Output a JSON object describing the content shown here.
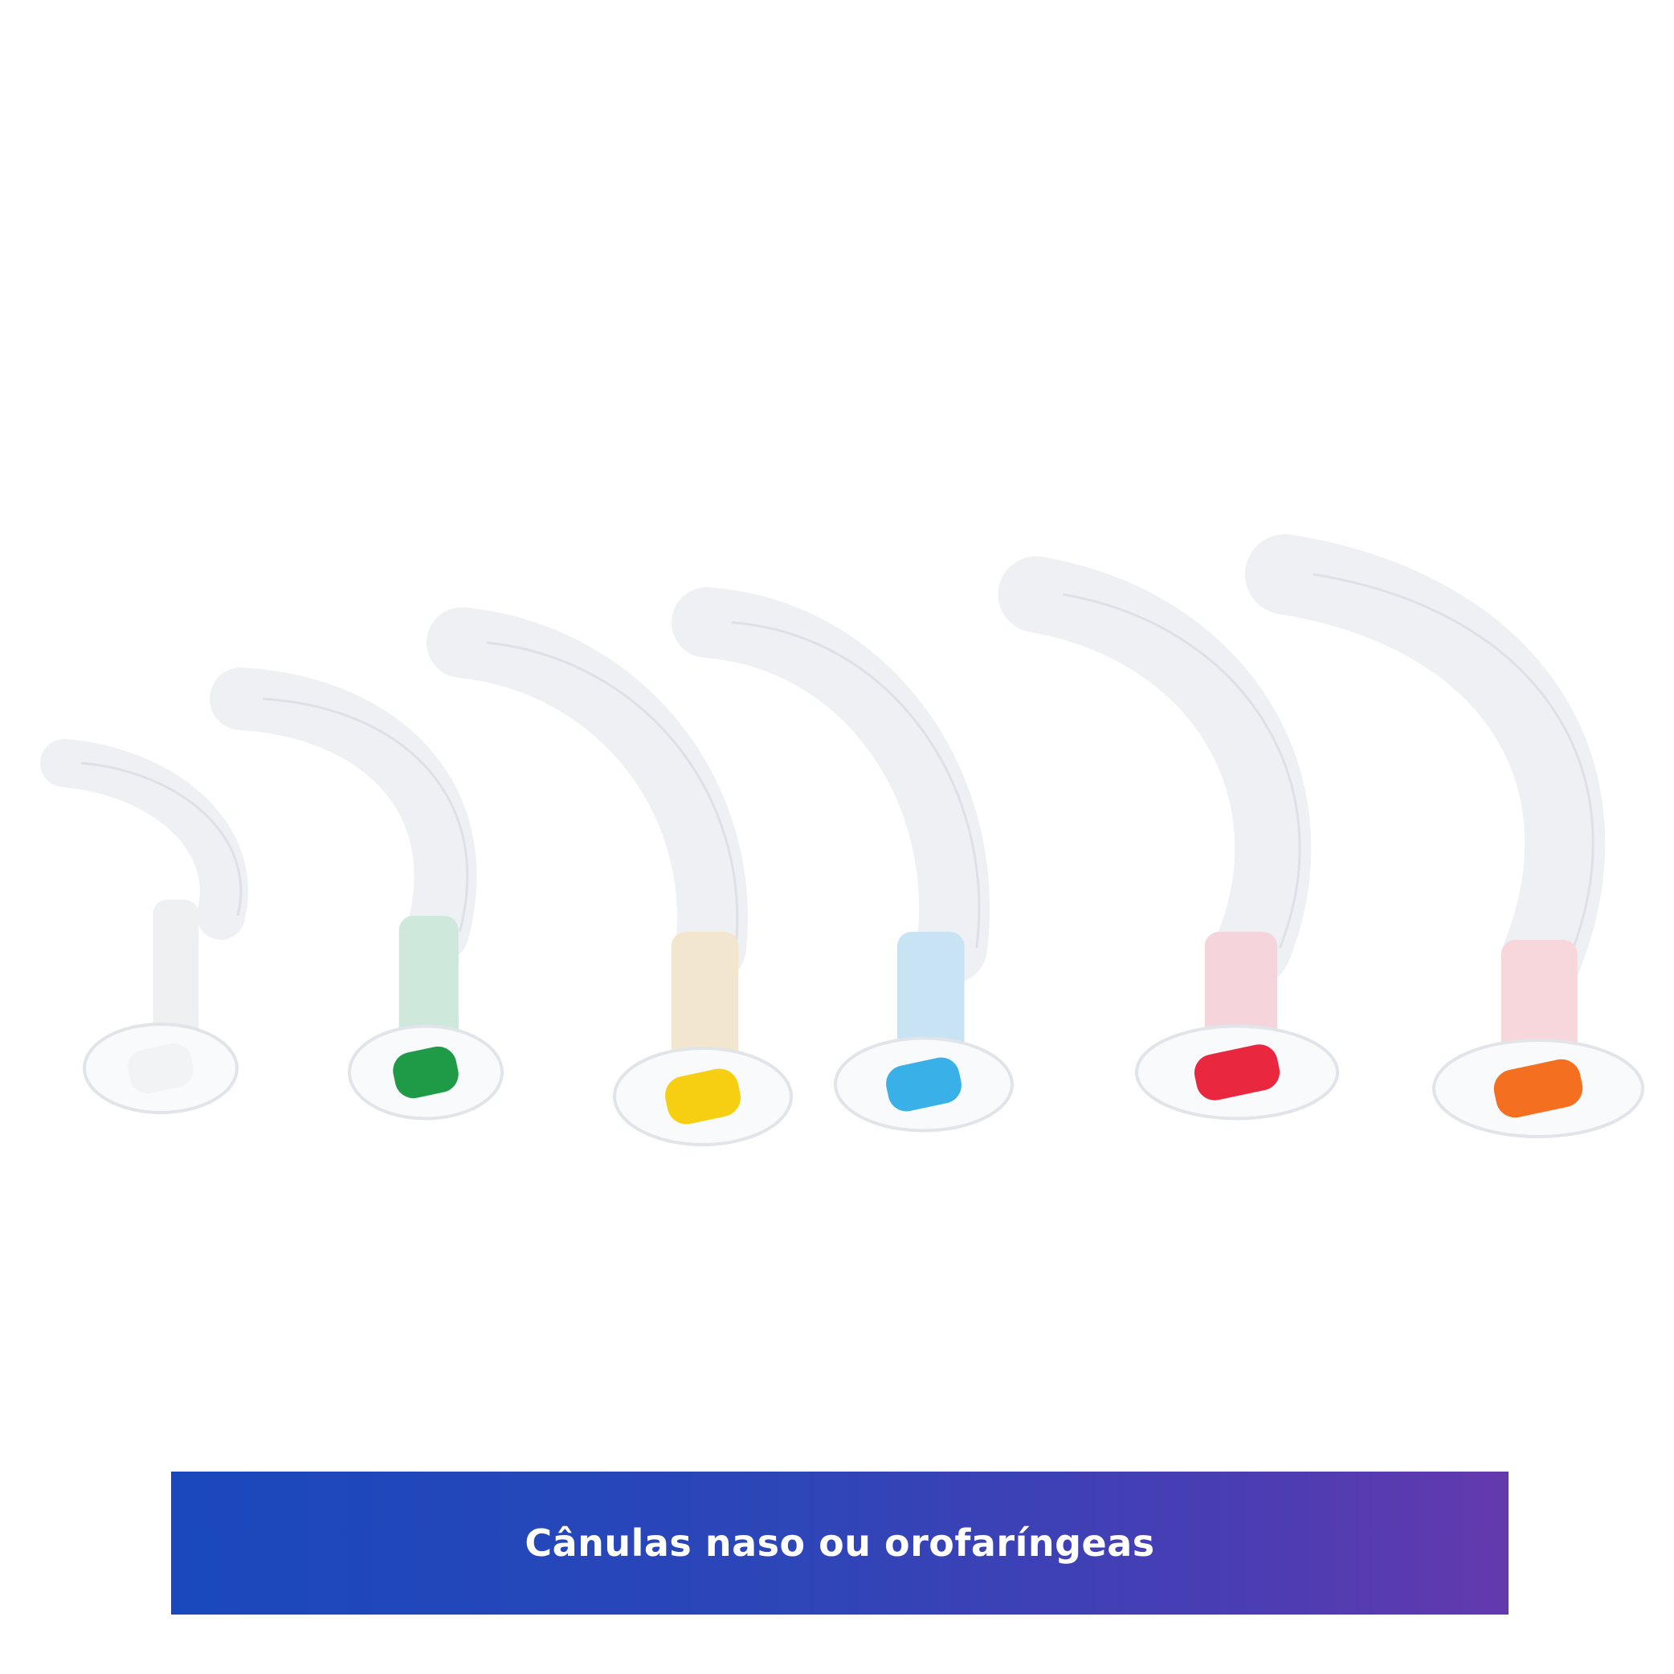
{
  "caption": {
    "text": "Cânulas naso ou orofaríngeas"
  },
  "colors": {
    "background": "#ffffff",
    "banner_start": "#1948bd",
    "banner_end": "#6439ae",
    "banner_text": "#ffffff"
  },
  "airways": [
    {
      "name": "airway-white",
      "insert_color": "#f1f3f5",
      "tint": "#eef0f2"
    },
    {
      "name": "airway-green",
      "insert_color": "#1f9a47",
      "tint": "#cfe8dc"
    },
    {
      "name": "airway-yellow",
      "insert_color": "#f7cf12",
      "tint": "#f3e6cf"
    },
    {
      "name": "airway-blue",
      "insert_color": "#3ab0e8",
      "tint": "#c8e3f4"
    },
    {
      "name": "airway-red",
      "insert_color": "#e9283f",
      "tint": "#f6d4dc"
    },
    {
      "name": "airway-orange",
      "insert_color": "#f46f1f",
      "tint": "#f7d6dc"
    }
  ]
}
